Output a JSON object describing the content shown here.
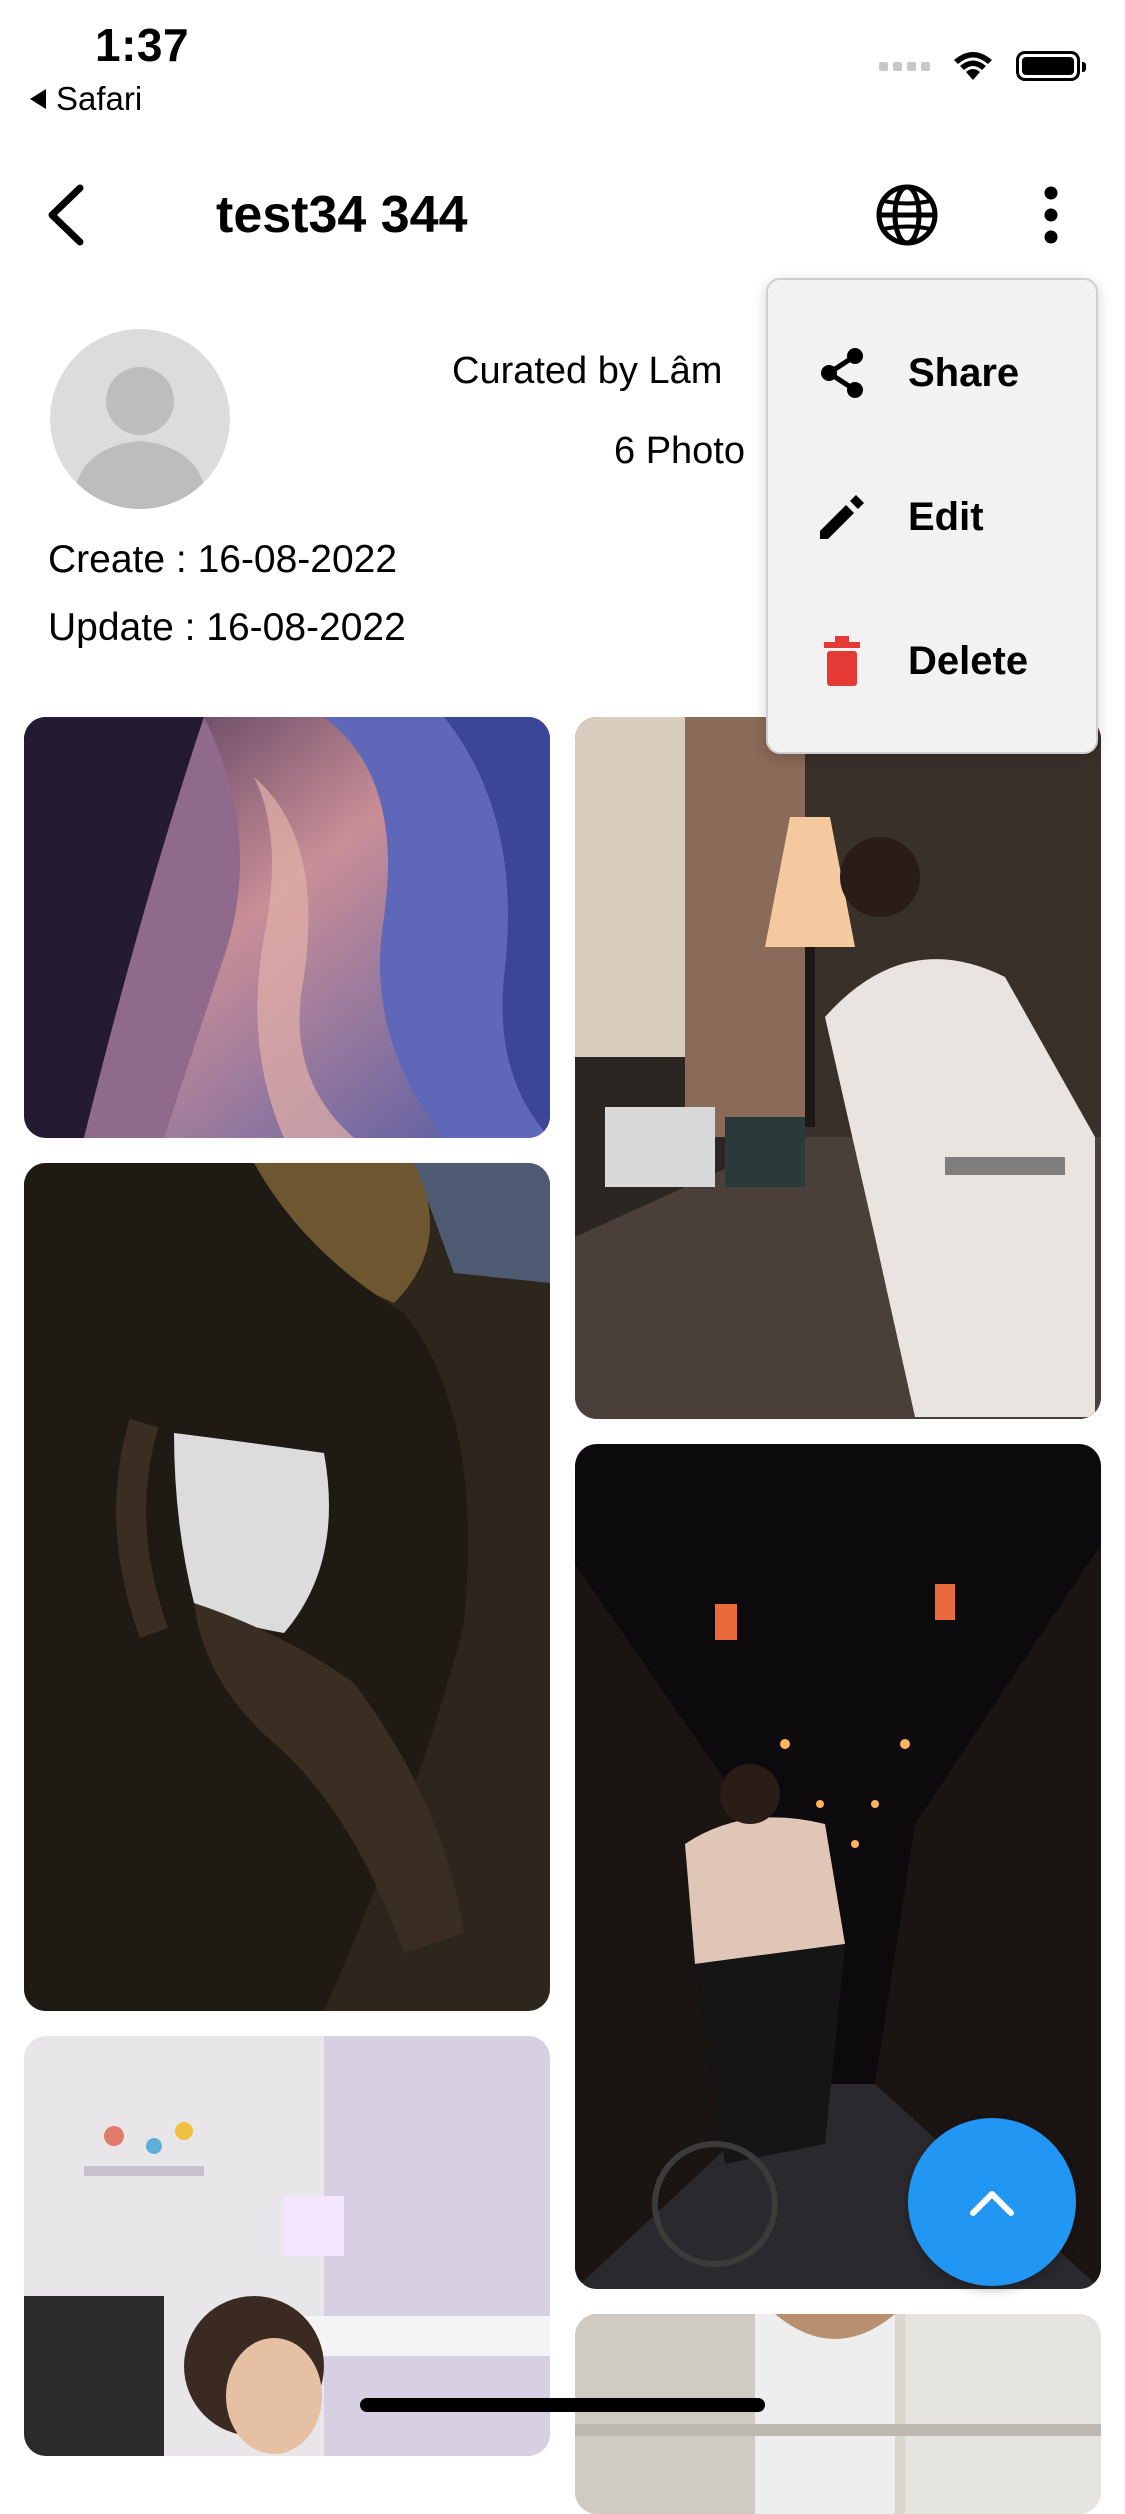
{
  "status_bar": {
    "time": "1:37",
    "back_app": "Safari"
  },
  "header": {
    "title": "test34 344"
  },
  "profile": {
    "curated_by": "Curated by Lâm",
    "photo_count": "6 Photo",
    "create_date": "Create : 16-08-2022",
    "update_date": "Update : 16-08-2022"
  },
  "menu": {
    "items": [
      {
        "label": "Share",
        "icon": "share-icon"
      },
      {
        "label": "Edit",
        "icon": "edit-icon"
      },
      {
        "label": "Delete",
        "icon": "delete-icon",
        "icon_color": "#e53935"
      }
    ]
  },
  "photos": [
    {
      "name": "canyon"
    },
    {
      "name": "man-at-desk"
    },
    {
      "name": "woman-on-rock"
    },
    {
      "name": "night-street-cyclist"
    },
    {
      "name": "woman-at-desk"
    },
    {
      "name": "kitchen"
    }
  ],
  "colors": {
    "fab": "#2196f3",
    "menu_bg": "#f2f2f2",
    "delete": "#e53935",
    "avatar_bg": "#dcdcdc"
  }
}
